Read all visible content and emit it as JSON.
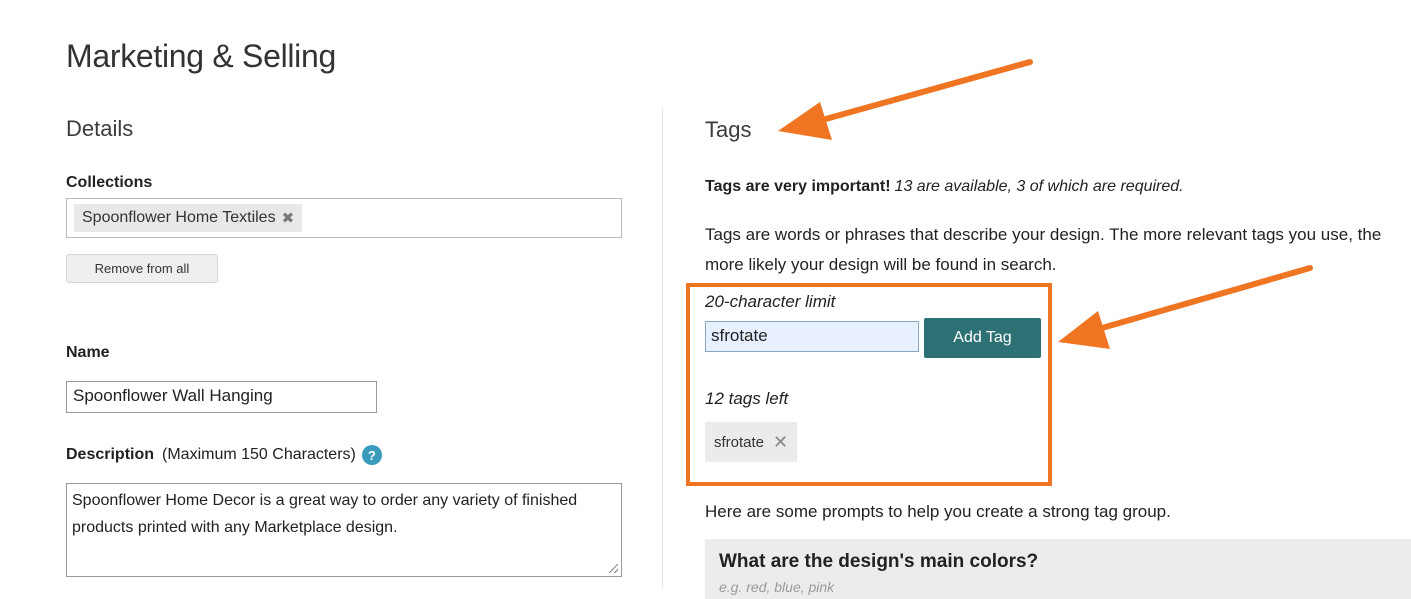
{
  "page": {
    "title": "Marketing & Selling"
  },
  "details": {
    "title": "Details",
    "collections": {
      "label": "Collections",
      "chips": [
        {
          "label": "Spoonflower Home Textiles",
          "remove_glyph": "✖"
        }
      ],
      "remove_all_label": "Remove from all"
    },
    "name": {
      "label": "Name",
      "value": "Spoonflower Wall Hanging"
    },
    "description": {
      "label": "Description",
      "hint": "(Maximum 150 Characters)",
      "help_glyph": "?",
      "value": "Spoonflower Home Decor is a great way to order any variety of finished products printed with any Marketplace design."
    }
  },
  "tags": {
    "title": "Tags",
    "important_bold": "Tags are very important!",
    "important_italic": "13 are available, 3 of which are required.",
    "info": "Tags are words or phrases that describe your design. The more relevant tags you use, the more likely your design will be found in search.",
    "char_limit": "20-character limit",
    "input_value": "sfrotate",
    "add_button_label": "Add Tag",
    "tags_left": "12 tags left",
    "chips": [
      {
        "label": "sfrotate",
        "remove_glyph": "✕"
      }
    ],
    "prompts_intro": "Here are some prompts to help you create a strong tag group.",
    "prompts": [
      {
        "question": "What are the design's main colors?",
        "hint": "e.g. red, blue, pink"
      }
    ]
  },
  "colors": {
    "accent_orange": "#f07522",
    "add_button_bg": "#2e7174",
    "help_icon_bg": "#3a9bbd",
    "input_highlight": "#e8f0fe"
  }
}
